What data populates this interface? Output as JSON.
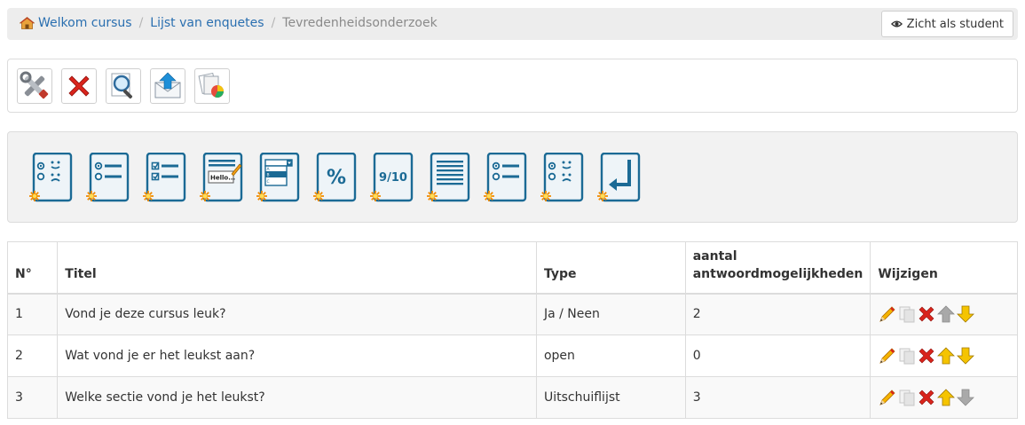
{
  "breadcrumb": {
    "items": [
      "Welkom cursus",
      "Lijst van enquetes",
      "Tevredenheidsonderzoek"
    ]
  },
  "student_view_label": "Zicht als student",
  "toolbar_icons": [
    "tools-icon",
    "delete-icon",
    "preview-icon",
    "send-mail-icon",
    "report-icon"
  ],
  "question_types": [
    "yes-no",
    "multiple-choice",
    "multiple-response",
    "open",
    "dropdown",
    "percentage",
    "score",
    "comment",
    "multiple-choice-other",
    "selective-display",
    "pagebreak"
  ],
  "table": {
    "headers": {
      "no": "N°",
      "title": "Titel",
      "type": "Type",
      "answers_line1": "aantal",
      "answers_line2": "antwoordmogelijkheden",
      "edit": "Wijzigen"
    },
    "rows": [
      {
        "no": "1",
        "title": "Vond je deze cursus leuk?",
        "type": "Ja / Neen",
        "answers": "2",
        "up_enabled": false,
        "down_enabled": true
      },
      {
        "no": "2",
        "title": "Wat vond je er het leukst aan?",
        "type": "open",
        "answers": "0",
        "up_enabled": true,
        "down_enabled": true
      },
      {
        "no": "3",
        "title": "Welke sectie vond je het leukst?",
        "type": "Uitschuiflijst",
        "answers": "3",
        "up_enabled": true,
        "down_enabled": false
      }
    ]
  },
  "colors": {
    "link": "#2a6fb0",
    "accent_blue": "#1b6a95",
    "star": "#f08a00",
    "arrow_yellow": "#f5c400"
  }
}
